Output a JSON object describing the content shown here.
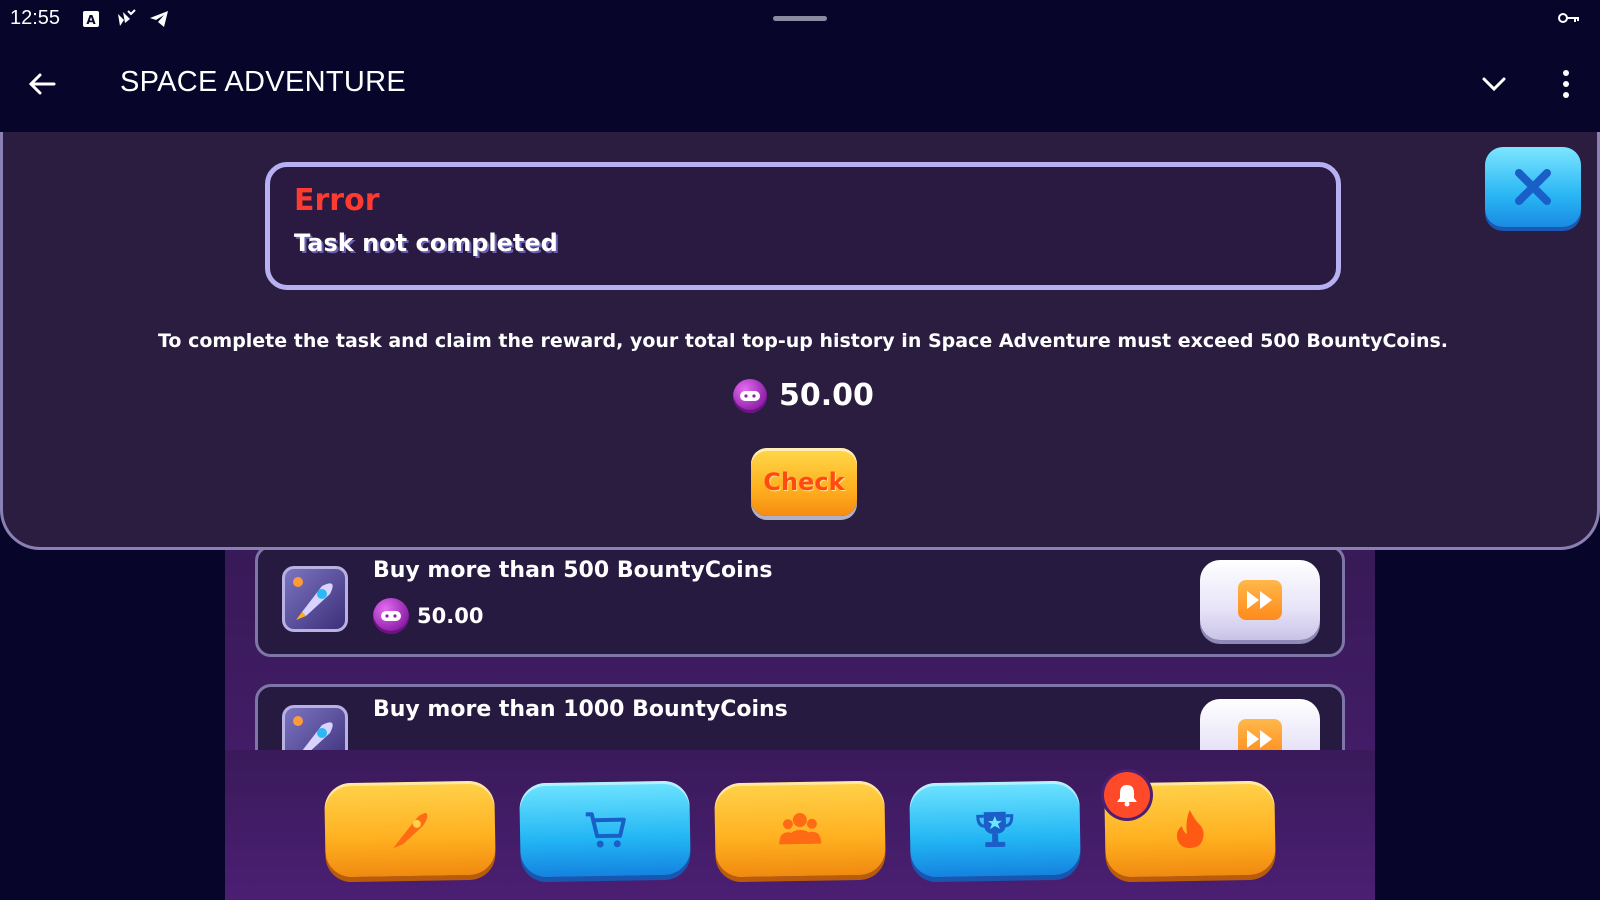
{
  "status_bar": {
    "time": "12:55"
  },
  "app_bar": {
    "title": "SPACE ADVENTURE"
  },
  "modal": {
    "error_title": "Error",
    "error_message": "Task not completed",
    "description": "To complete the task and claim the reward, your total top-up history in Space Adventure must exceed 500 BountyCoins.",
    "reward_amount": "50.00",
    "check_label": "Check"
  },
  "tasks": [
    {
      "title": "Buy more than 500 BountyCoins",
      "reward": "50.00"
    },
    {
      "title": "Buy more than 1000 BountyCoins",
      "reward": ""
    }
  ],
  "bottom_nav": [
    {
      "icon": "rocket-icon",
      "color": "orange"
    },
    {
      "icon": "cart-icon",
      "color": "blue"
    },
    {
      "icon": "friends-icon",
      "color": "orange"
    },
    {
      "icon": "trophy-icon",
      "color": "blue"
    },
    {
      "icon": "fire-icon",
      "color": "orange",
      "badge": "bell-icon"
    }
  ],
  "colors": {
    "error_red": "#ff3b30",
    "accent_orange": "#ffb020",
    "accent_blue": "#23b6f4",
    "coin_purple": "#b03ec8",
    "background": "#07062a"
  }
}
